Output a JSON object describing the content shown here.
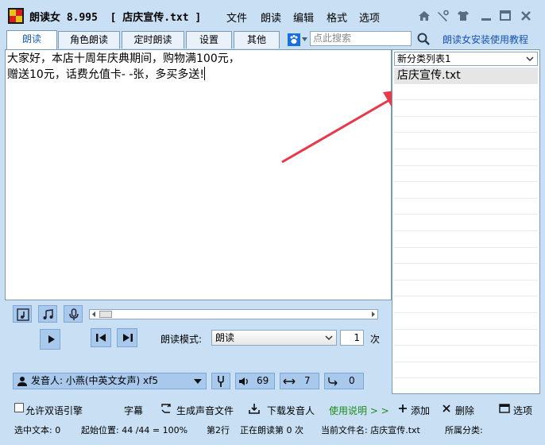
{
  "title": {
    "app_name": "朗读女 8.995",
    "doc_name": "[ 店庆宣传.txt ]"
  },
  "menu": [
    "文件",
    "朗读",
    "编辑",
    "格式",
    "选项"
  ],
  "tabs": [
    "朗读",
    "角色朗读",
    "定时朗读",
    "设置",
    "其他"
  ],
  "search": {
    "placeholder": "点此搜索"
  },
  "help_link": "朗读女安装使用教程",
  "editor": {
    "line1": "大家好，本店十周年庆典期间，购物满100元，",
    "line2": "赠送10元，话费允值卡- -张，多买多送!"
  },
  "right_panel": {
    "category": "新分类列表1",
    "files": [
      "店庆宣传.txt"
    ]
  },
  "controls": {
    "mode_label": "朗读模式:",
    "mode_value": "朗读",
    "repeat": "1",
    "repeat_unit": "次",
    "voice_label": "发音人: 小燕(中英文女声) xf5",
    "pitch": "69",
    "speed": "7",
    "pause": "0"
  },
  "bottom": {
    "allow_dual": "允许双语引擎",
    "subtitle": "字幕",
    "generate_audio": "生成声音文件",
    "download_voice": "下载发音人",
    "instructions": "使用说明 > >",
    "add": "添加",
    "delete": "删除",
    "options": "选项"
  },
  "status": {
    "selected": "选中文本: 0",
    "start_pos": "起始位置: 44 /44 = 100%",
    "line": "第2行",
    "reading": "正在朗读第 0 次",
    "current_file": "当前文件名: 店庆宣传.txt",
    "category": "所属分类:"
  },
  "colors": {
    "window_bg": "#c9dff3",
    "button_bg": "#a8c8ec",
    "link": "#1553b4",
    "green_link": "#1a8c1a",
    "arrow": "#e8384a"
  }
}
